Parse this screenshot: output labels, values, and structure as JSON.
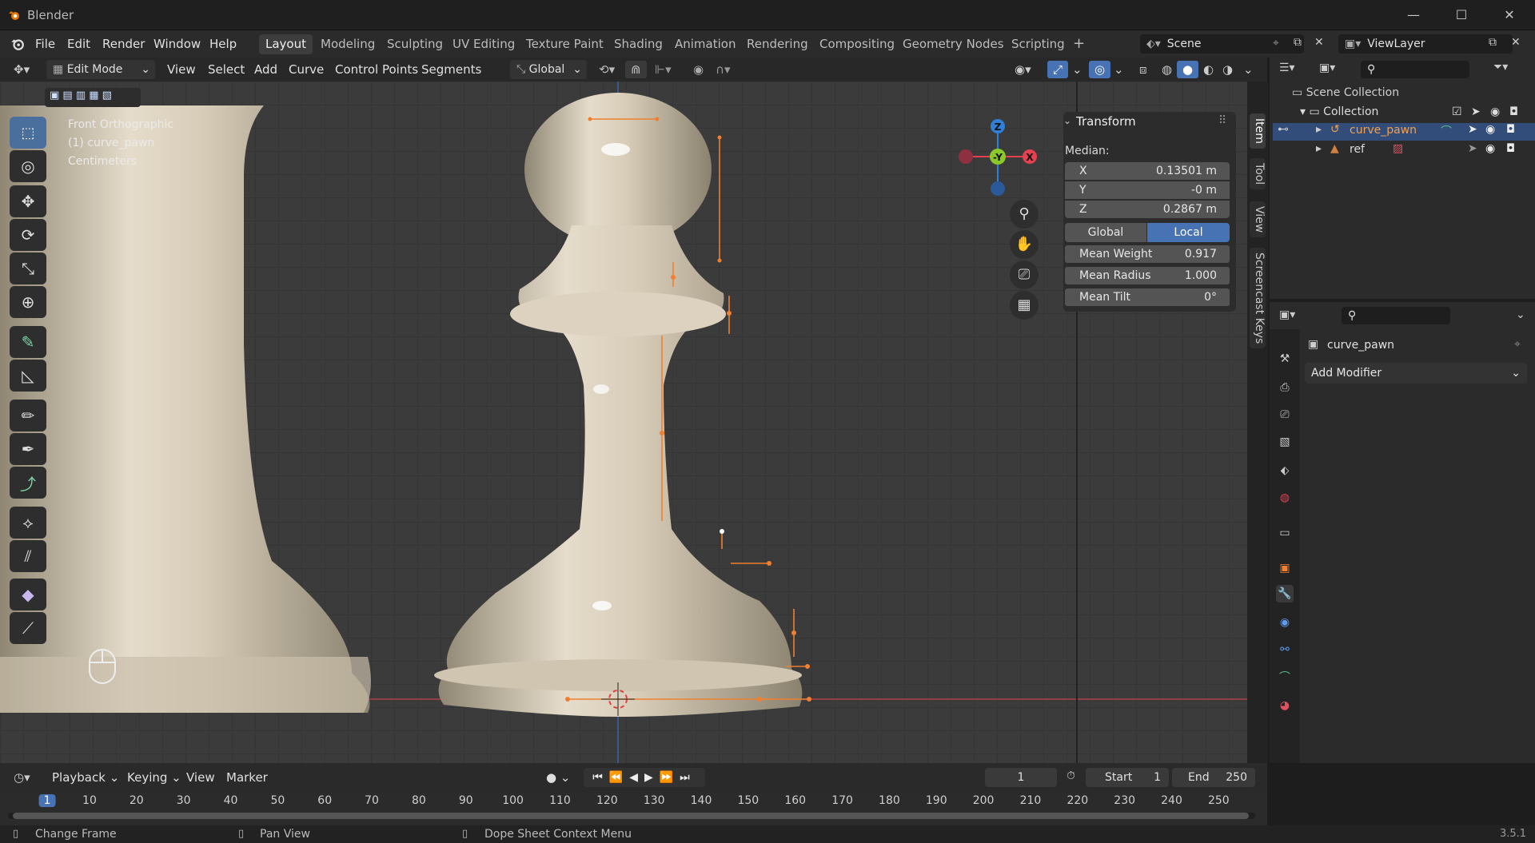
{
  "app": {
    "title": "Blender",
    "version": "3.5.1"
  },
  "menus": [
    "File",
    "Edit",
    "Render",
    "Window",
    "Help"
  ],
  "workspaces": [
    "Layout",
    "Modeling",
    "Sculpting",
    "UV Editing",
    "Texture Paint",
    "Shading",
    "Animation",
    "Rendering",
    "Compositing",
    "Geometry Nodes",
    "Scripting"
  ],
  "active_workspace": "Layout",
  "scene": {
    "name": "Scene",
    "view_layer": "ViewLayer"
  },
  "header3d": {
    "mode": "Edit Mode",
    "menus": [
      "View",
      "Select",
      "Add",
      "Curve",
      "Control Points",
      "Segments"
    ],
    "orientation": "Global"
  },
  "overlay": {
    "line1": "Front Orthographic",
    "line2": "(1) curve_pawn",
    "line3": "Centimeters"
  },
  "gizmo": {
    "z": "Z",
    "y": "-Y",
    "x": "X"
  },
  "npanel": {
    "section": "Transform",
    "median_label": "Median:",
    "x_label": "X",
    "x_value": "0.13501 m",
    "y_label": "Y",
    "y_value": "-0 m",
    "z_label": "Z",
    "z_value": "0.2867 m",
    "global_btn": "Global",
    "local_btn": "Local",
    "weight_label": "Mean Weight",
    "weight_value": "0.917",
    "radius_label": "Mean Radius",
    "radius_value": "1.000",
    "tilt_label": "Mean Tilt",
    "tilt_value": "0°"
  },
  "side_tabs": [
    "Item",
    "Tool",
    "View",
    "Screencast Keys"
  ],
  "outliner": {
    "scene_collection": "Scene Collection",
    "collection": "Collection",
    "items": [
      "curve_pawn",
      "ref"
    ]
  },
  "properties": {
    "object_name": "curve_pawn",
    "add_modifier": "Add Modifier"
  },
  "timeline": {
    "menus": [
      "Playback",
      "Keying",
      "View",
      "Marker"
    ],
    "current_frame": "1",
    "start_label": "Start",
    "start_value": "1",
    "end_label": "End",
    "end_value": "250",
    "ticks": [
      "1",
      "10",
      "20",
      "30",
      "40",
      "50",
      "60",
      "70",
      "80",
      "90",
      "100",
      "110",
      "120",
      "130",
      "140",
      "150",
      "160",
      "170",
      "180",
      "190",
      "200",
      "210",
      "220",
      "230",
      "240",
      "250"
    ]
  },
  "status": {
    "left": "Change Frame",
    "middle": "Pan View",
    "right": "Dope Sheet Context Menu"
  },
  "colors": {
    "accent": "#4772b3",
    "axis_x": "#e4404f",
    "axis_y": "#8ac82b",
    "axis_z": "#2f7fd8",
    "orange": "#f08030"
  }
}
